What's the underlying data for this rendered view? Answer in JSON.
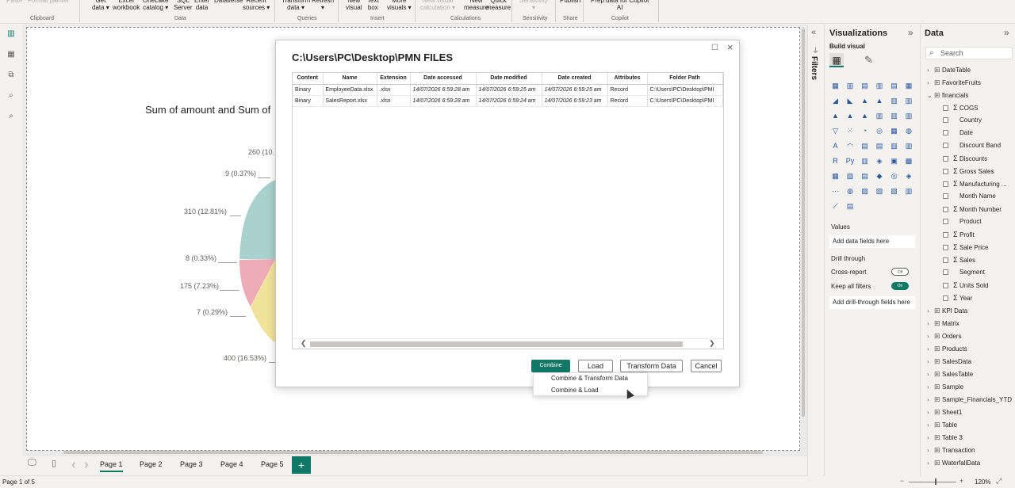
{
  "ribbon": {
    "buttons": [
      {
        "key": "paste",
        "label": "Paste",
        "dim": true
      },
      {
        "key": "format_painter",
        "label": "Format painter",
        "dim": true
      },
      {
        "key": "get_data",
        "label": "Get\ndata ▾"
      },
      {
        "key": "excel",
        "label": "Excel\nworkbook"
      },
      {
        "key": "onelake",
        "label": "OneLake\ncatalog ▾"
      },
      {
        "key": "sql",
        "label": "SQL\nServer"
      },
      {
        "key": "enter_data",
        "label": "Enter\ndata"
      },
      {
        "key": "dataverse",
        "label": "Dataverse"
      },
      {
        "key": "recent",
        "label": "Recent\nsources ▾"
      },
      {
        "key": "transform",
        "label": "Transform\ndata ▾"
      },
      {
        "key": "refresh",
        "label": "Refresh\n▾"
      },
      {
        "key": "new_visual",
        "label": "New\nvisual"
      },
      {
        "key": "text_box",
        "label": "Text\nbox"
      },
      {
        "key": "more_visuals",
        "label": "More\nvisuals ▾"
      },
      {
        "key": "new_visual_calc",
        "label": "New visual\ncalculation ▾",
        "dim": true
      },
      {
        "key": "new_measure",
        "label": "New\nmeasure"
      },
      {
        "key": "quick_measure",
        "label": "Quick\nmeasure"
      },
      {
        "key": "sensitivity",
        "label": "Sensitivity\n▾",
        "dim": true
      },
      {
        "key": "publish",
        "label": "Publish"
      },
      {
        "key": "prep_copilot",
        "label": "Prep data for Copilot\nAI"
      }
    ],
    "groups": [
      "Clipboard",
      "Data",
      "Queries",
      "Insert",
      "Calculations",
      "Sensitivity",
      "Share",
      "Copilot"
    ]
  },
  "chart": {
    "title": "Sum of amount and Sum of",
    "chart_data": {
      "type": "pie",
      "title": "Sum of amount and Sum of",
      "partially_obscured": true,
      "slices": [
        {
          "label": "260 (10.",
          "value": 260
        },
        {
          "label": "9 (0.37%)",
          "value": 9,
          "percent": 0.37
        },
        {
          "label": "310 (12.81%)",
          "value": 310,
          "percent": 12.81
        },
        {
          "label": "8 (0.33%)",
          "value": 8,
          "percent": 0.33
        },
        {
          "label": "175 (7.23%)",
          "value": 175,
          "percent": 7.23
        },
        {
          "label": "7 (0.29%)",
          "value": 7,
          "percent": 0.29
        },
        {
          "label": "400 (16.53%)",
          "value": 400,
          "percent": 16.53
        }
      ],
      "colors": [
        "#a9d1cf",
        "#eeacb6",
        "#f2e39a"
      ]
    }
  },
  "dialog": {
    "title": "C:\\Users\\PC\\Desktop\\PMN FILES",
    "columns": [
      "Content",
      "Name",
      "Extension",
      "Date accessed",
      "Date modified",
      "Date created",
      "Attributes",
      "Folder Path"
    ],
    "rows": [
      [
        "Binary",
        "EmployeeData.xlsx",
        ".xlsx",
        "14/07/2026 6:59:28 am",
        "14/07/2026 6:59:25 am",
        "14/07/2026 6:59:25 am",
        "Record",
        "C:\\Users\\PC\\Desktop\\PMI"
      ],
      [
        "Binary",
        "SalesReport.xlsx",
        ".xlsx",
        "14/07/2026 6:59:28 am",
        "14/07/2026 6:59:24 am",
        "14/07/2026 6:59:23 am",
        "Record",
        "C:\\Users\\PC\\Desktop\\PMI"
      ]
    ],
    "buttons": {
      "combine": "Combine",
      "load": "Load",
      "transform": "Transform Data",
      "cancel": "Cancel"
    },
    "combine_menu": [
      "Combine & Transform Data",
      "Combine & Load"
    ]
  },
  "pages": {
    "tabs": [
      "Page 1",
      "Page 2",
      "Page 3",
      "Page 4",
      "Page 5"
    ],
    "active": "Page 1",
    "add": "+"
  },
  "status": {
    "page": "Page 1 of 5",
    "zoom": "120%"
  },
  "filters": {
    "label": "Filters"
  },
  "visualizations": {
    "title": "Visualizations",
    "build_visual": "Build visual",
    "values_label": "Values",
    "values_placeholder": "Add data fields here",
    "drill_through": "Drill through",
    "cross_report": "Cross-report",
    "cross_report_state": "Off",
    "keep_filters": "Keep all filters",
    "keep_filters_state": "On",
    "drill_placeholder": "Add drill-through fields here",
    "icons": [
      "▦",
      "▥",
      "▤",
      "▥",
      "▤",
      "▦",
      "◢",
      "◣",
      "▲",
      "▲",
      "▥",
      "▥",
      "▲",
      "▲",
      "▲",
      "▥",
      "▥",
      "▥",
      "▽",
      "⁙",
      "◔",
      "◎",
      "▦",
      "◍",
      "A",
      "◠",
      "▤",
      "▤",
      "▥",
      "▥",
      "R",
      "Py",
      "▥",
      "◈",
      "▣",
      "▩",
      "▦",
      "▨",
      "▤",
      "◆",
      "◎",
      "◈",
      "⋯",
      "◍",
      "▨",
      "▨",
      "▨",
      "▥",
      "⟋",
      "▤"
    ]
  },
  "data_panel": {
    "title": "Data",
    "search_placeholder": "Search",
    "tables_before": [
      "DateTable",
      "FavoriteFruits"
    ],
    "expanded": {
      "name": "financials",
      "fields": [
        {
          "name": "COGS",
          "sigma": true
        },
        {
          "name": "Country",
          "sigma": false
        },
        {
          "name": "Date",
          "sigma": false
        },
        {
          "name": "Discount Band",
          "sigma": false
        },
        {
          "name": "Discounts",
          "sigma": true
        },
        {
          "name": "Gross Sales",
          "sigma": true
        },
        {
          "name": "Manufacturing ...",
          "sigma": true
        },
        {
          "name": "Month Name",
          "sigma": false
        },
        {
          "name": "Month Number",
          "sigma": true
        },
        {
          "name": "Product",
          "sigma": false
        },
        {
          "name": "Profit",
          "sigma": true
        },
        {
          "name": "Sale Price",
          "sigma": true
        },
        {
          "name": "Sales",
          "sigma": true
        },
        {
          "name": "Segment",
          "sigma": false
        },
        {
          "name": "Units Sold",
          "sigma": true
        },
        {
          "name": "Year",
          "sigma": true
        }
      ]
    },
    "tables_after": [
      "KPI Data",
      "Matrix",
      "Orders",
      "Products",
      "SalesData",
      "SalesTable",
      "Sample",
      "Sample_Financials_YTD",
      "Sheet1",
      "Table",
      "Table 3",
      "Transaction",
      "WaterfallData"
    ]
  }
}
